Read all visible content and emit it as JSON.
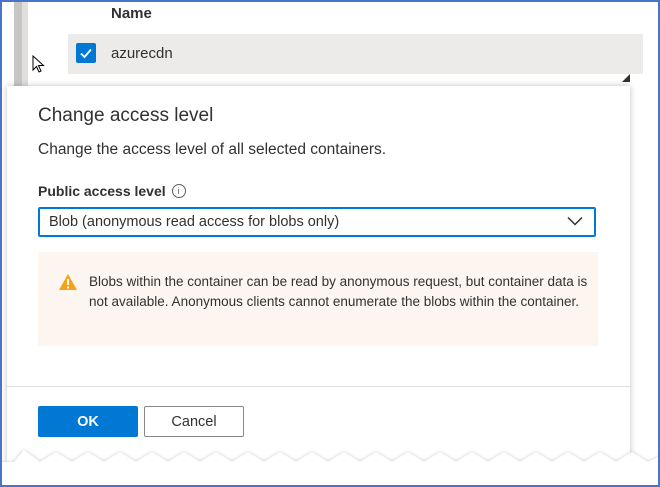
{
  "table": {
    "column_header": "Name",
    "rows": [
      {
        "label": "azurecdn",
        "selected": true
      }
    ]
  },
  "panel": {
    "title": "Change access level",
    "subtitle": "Change the access level of all selected containers.",
    "field_label": "Public access level",
    "info_icon": "info-icon",
    "dropdown_value": "Blob (anonymous read access for blobs only)",
    "warning_text": "Blobs within the container can be read by anonymous request, but container data is not available. Anonymous clients cannot enumerate the blobs within the container.",
    "ok_label": "OK",
    "cancel_label": "Cancel"
  },
  "colors": {
    "accent": "#0078d4",
    "warning_icon": "#f7a117",
    "warning_bg": "#fdf6f0",
    "frame_border": "#4a74c9"
  }
}
